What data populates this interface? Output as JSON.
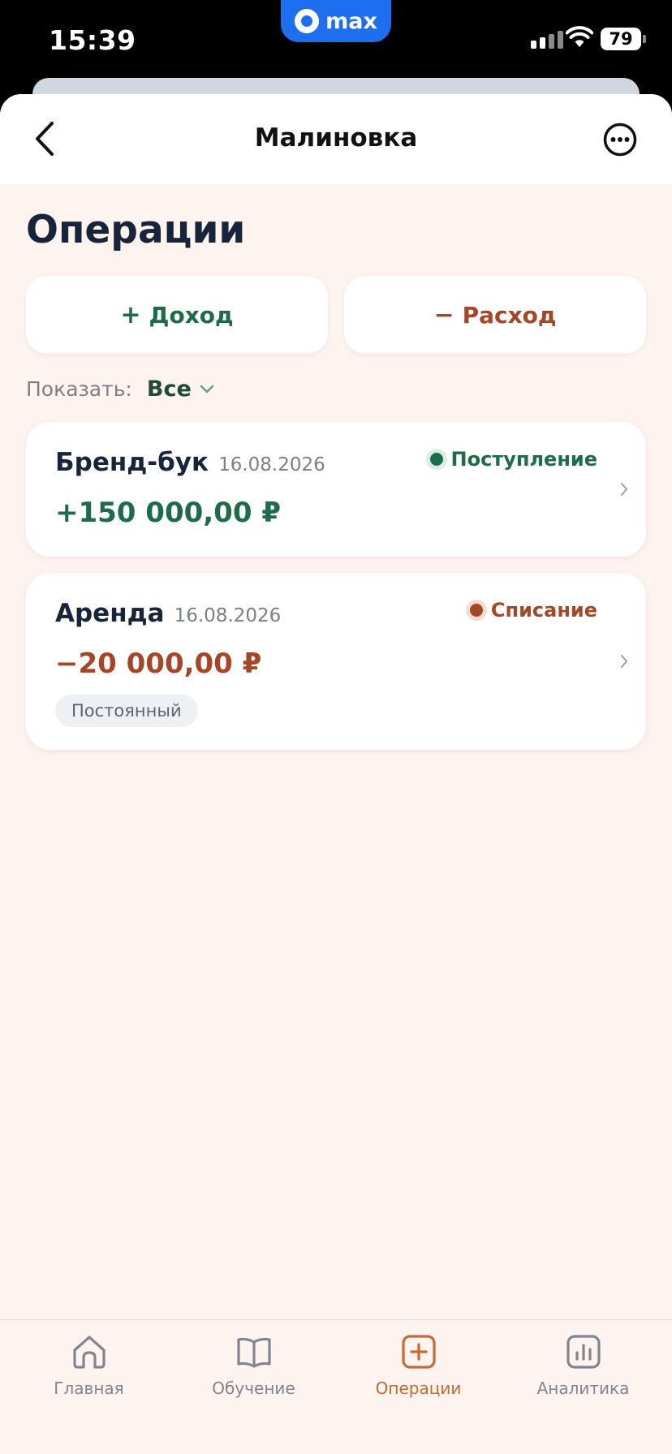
{
  "status_bar": {
    "time": "15:39",
    "pill_label": "max",
    "battery": "79"
  },
  "header": {
    "title": "Малиновка",
    "back_icon": "chevron-left-icon",
    "more_icon": "more-horizontal-icon"
  },
  "page": {
    "title": "Операции"
  },
  "actions": {
    "income": {
      "sign": "+",
      "label": "Доход"
    },
    "expense": {
      "sign": "−",
      "label": "Расход"
    }
  },
  "filter": {
    "label": "Показать:",
    "value": "Все"
  },
  "operations": [
    {
      "name": "Бренд-бук",
      "date": "16.08.2026",
      "amount": "+150 000,00 ₽",
      "status": "Поступление",
      "type": "income"
    },
    {
      "name": "Аренда",
      "date": "16.08.2026",
      "amount": "−20 000,00 ₽",
      "status": "Списание",
      "type": "expense",
      "tag": "Постоянный"
    }
  ],
  "tabs": [
    {
      "label": "Главная",
      "icon": "home-icon",
      "active": false
    },
    {
      "label": "Обучение",
      "icon": "book-icon",
      "active": false
    },
    {
      "label": "Операции",
      "icon": "plus-square-icon",
      "active": true
    },
    {
      "label": "Аналитика",
      "icon": "bar-chart-icon",
      "active": false
    }
  ],
  "colors": {
    "income": "#1e6b4a",
    "expense": "#a54626",
    "active_tab": "#c56a36",
    "background": "#fdf3ef",
    "status_pill": "#1e6ff0"
  }
}
